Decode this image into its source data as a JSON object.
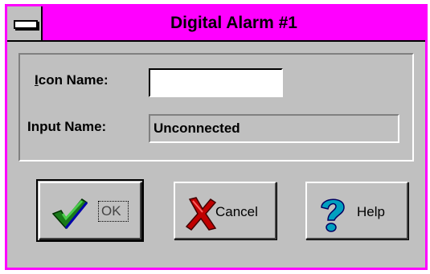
{
  "window": {
    "title": "Digital Alarm #1",
    "title_color": "#ff00ff"
  },
  "form": {
    "icon_name_label": "Icon Name:",
    "icon_name_mnemonic": "I",
    "icon_name_rest": "con Name:",
    "icon_name_value": "",
    "input_name_label": "Input Name:",
    "input_name_value": "Unconnected"
  },
  "buttons": {
    "ok": {
      "label": "OK",
      "icon": "check-icon"
    },
    "cancel": {
      "label": "Cancel",
      "icon": "x-icon"
    },
    "help": {
      "label": "Help",
      "icon": "question-icon"
    }
  }
}
